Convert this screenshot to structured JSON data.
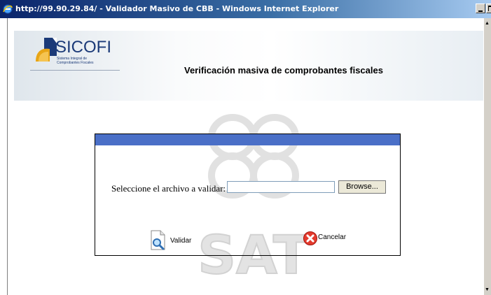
{
  "window": {
    "title": "http://99.90.29.84/ - Validador Masivo de CBB - Windows Internet Explorer"
  },
  "header": {
    "brand": "SICOFI",
    "tagline_line1": "Sistema Integral de",
    "tagline_line2": "Comprobantes Fiscales",
    "heading": "Verificación masiva de comprobantes fiscales"
  },
  "form": {
    "file_label": "Seleccione el archivo a validar:",
    "file_value": "",
    "browse_label": "Browse...",
    "validate_label": "Validar",
    "cancel_label": "Cancelar"
  },
  "colors": {
    "panel_header": "#4a6fc7",
    "brand_blue": "#1b3a78"
  }
}
